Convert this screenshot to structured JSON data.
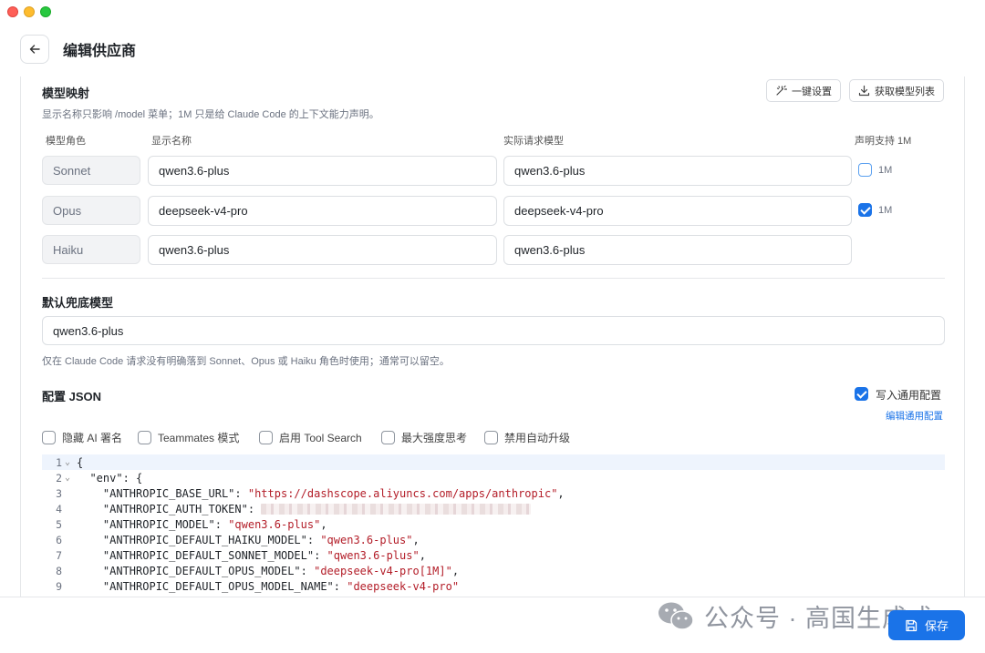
{
  "window": {
    "title": "编辑供应商"
  },
  "model_mapping": {
    "title": "模型映射",
    "hint": "显示名称只影响 /model 菜单；1M 只是给 Claude Code 的上下文能力声明。",
    "one_click_label": "一键设置",
    "fetch_list_label": "获取模型列表",
    "columns": {
      "role": "模型角色",
      "display": "显示名称",
      "actual": "实际请求模型",
      "support_1m": "声明支持 1M"
    },
    "rows": [
      {
        "role": "Sonnet",
        "display": "qwen3.6-plus",
        "actual": "qwen3.6-plus",
        "m1_label": "1M",
        "m1_checked": false
      },
      {
        "role": "Opus",
        "display": "deepseek-v4-pro",
        "actual": "deepseek-v4-pro",
        "m1_label": "1M",
        "m1_checked": true
      },
      {
        "role": "Haiku",
        "display": "qwen3.6-plus",
        "actual": "qwen3.6-plus"
      }
    ]
  },
  "fallback": {
    "title": "默认兜底模型",
    "value": "qwen3.6-plus",
    "hint": "仅在 Claude Code 请求没有明确落到 Sonnet、Opus 或 Haiku 角色时使用；通常可以留空。"
  },
  "config_json": {
    "title": "配置 JSON",
    "write_common_label": "写入通用配置",
    "write_common_checked": true,
    "edit_common_link": "编辑通用配置",
    "options": [
      {
        "label": "隐藏 AI 署名",
        "checked": false
      },
      {
        "label": "Teammates 模式",
        "checked": false
      },
      {
        "label": "启用 Tool Search",
        "checked": false
      },
      {
        "label": "最大强度思考",
        "checked": false
      },
      {
        "label": "禁用自动升级",
        "checked": false
      }
    ],
    "lines": [
      {
        "num": "1",
        "fold": "⌄",
        "indent": "",
        "key": "{",
        "value": "",
        "tail": ""
      },
      {
        "num": "2",
        "fold": "⌄",
        "indent": "  ",
        "key": "\"env\": {",
        "value": "",
        "tail": ""
      },
      {
        "num": "3",
        "fold": "",
        "indent": "    ",
        "key": "\"ANTHROPIC_BASE_URL\": ",
        "value": "\"https://dashscope.aliyuncs.com/apps/anthropic\"",
        "tail": ","
      },
      {
        "num": "4",
        "fold": "",
        "indent": "    ",
        "key": "\"ANTHROPIC_AUTH_TOKEN\": ",
        "value": "",
        "tail": "",
        "redacted": true
      },
      {
        "num": "5",
        "fold": "",
        "indent": "    ",
        "key": "\"ANTHROPIC_MODEL\": ",
        "value": "\"qwen3.6-plus\"",
        "tail": ","
      },
      {
        "num": "6",
        "fold": "",
        "indent": "    ",
        "key": "\"ANTHROPIC_DEFAULT_HAIKU_MODEL\": ",
        "value": "\"qwen3.6-plus\"",
        "tail": ","
      },
      {
        "num": "7",
        "fold": "",
        "indent": "    ",
        "key": "\"ANTHROPIC_DEFAULT_SONNET_MODEL\": ",
        "value": "\"qwen3.6-plus\"",
        "tail": ","
      },
      {
        "num": "8",
        "fold": "",
        "indent": "    ",
        "key": "\"ANTHROPIC_DEFAULT_OPUS_MODEL\": ",
        "value": "\"deepseek-v4-pro[1M]\"",
        "tail": ","
      },
      {
        "num": "9",
        "fold": "",
        "indent": "    ",
        "key": "\"ANTHROPIC_DEFAULT_OPUS_MODEL_NAME\": ",
        "value": "\"deepseek-v4-pro\"",
        "tail": ""
      }
    ]
  },
  "footer": {
    "save_label": "保存",
    "watermark": "公众号 · 高国生成式"
  },
  "colors": {
    "accent": "#1a73e8",
    "string": "#b31d28"
  }
}
